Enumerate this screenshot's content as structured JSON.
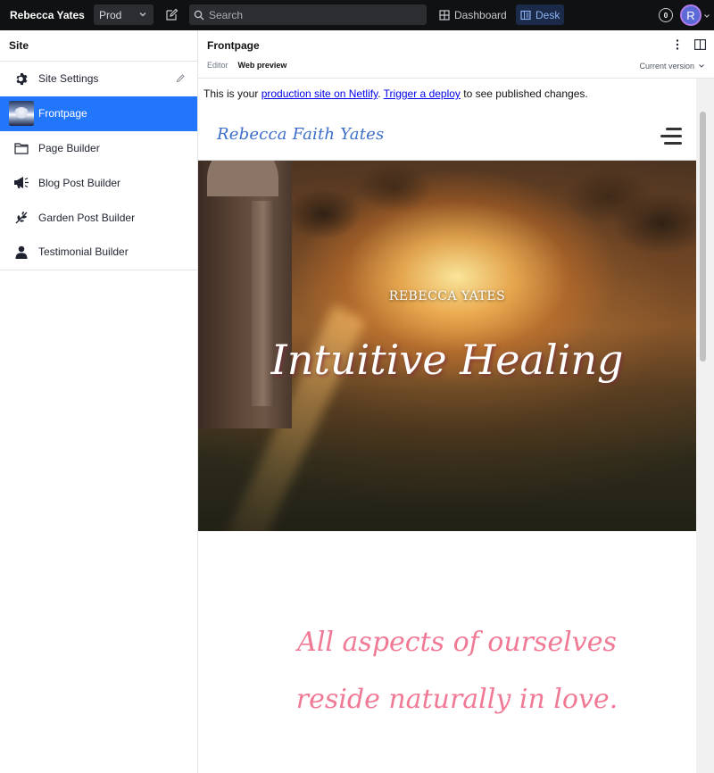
{
  "navbar": {
    "brand": "Rebecca Yates",
    "env_value": "Prod",
    "search_placeholder": "Search",
    "tools": {
      "dashboard": "Dashboard",
      "desk": "Desk"
    },
    "notification_count": "0",
    "avatar_initial": "R"
  },
  "sidebar": {
    "title": "Site",
    "items": [
      {
        "label": "Site Settings",
        "icon": "gear-icon"
      },
      {
        "label": "Frontpage",
        "icon": "thumbnail-image",
        "active": true
      },
      {
        "label": "Page Builder",
        "icon": "folder-icon"
      },
      {
        "label": "Blog Post Builder",
        "icon": "megaphone-icon"
      },
      {
        "label": "Garden Post Builder",
        "icon": "leaf-icon"
      },
      {
        "label": "Testimonial Builder",
        "icon": "person-icon"
      }
    ]
  },
  "document": {
    "title": "Frontpage",
    "tabs": [
      "Editor",
      "Web preview"
    ],
    "selected_tab": "Web preview",
    "version": "Current version"
  },
  "preview": {
    "notice": {
      "prefix": "This is your ",
      "link1": "production site on Netlify",
      "middle": ". ",
      "link2": "Trigger a deploy",
      "suffix": " to see published changes."
    },
    "site_logo": "Rebecca Faith Yates",
    "hero_kicker": "REBECCA YATES",
    "hero_title": "Intuitive Healing",
    "quote": "All aspects of ourselves reside naturally in love."
  },
  "colors": {
    "navbar_bg": "#101112",
    "active_item": "#2276fc",
    "link": "#0000ee",
    "logo_blue": "#3d6ec9",
    "quote_pink": "#f07a95"
  }
}
